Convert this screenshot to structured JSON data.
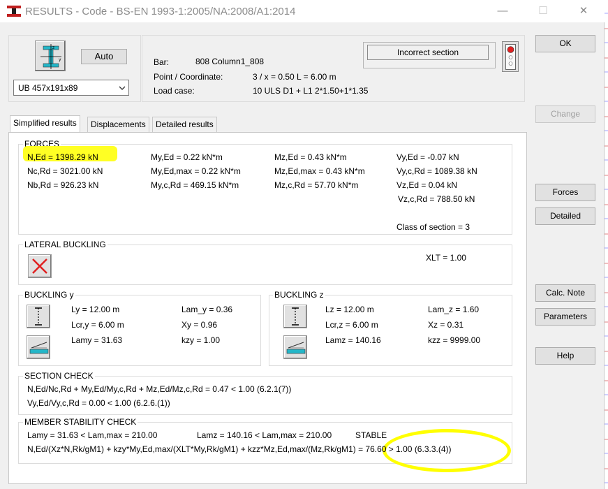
{
  "window": {
    "title": "RESULTS - Code - BS-EN 1993-1:2005/NA:2008/A1:2014",
    "minimize": "—",
    "maximize": "☐",
    "close": "✕"
  },
  "top_left": {
    "auto_label": "Auto",
    "section_value": "UB 457x191x89"
  },
  "info": {
    "bar_label": "Bar:",
    "bar_value": "808  Column1_808",
    "point_label": "Point / Coordinate:",
    "point_value": "3 / x = 0.50 L = 6.00 m",
    "load_label": "Load case:",
    "load_value": "10 ULS D1 + L1  2*1.50+1*1.35"
  },
  "status": {
    "message": "Incorrect section",
    "light_color": "#e02020"
  },
  "tabs": [
    "Simplified results",
    "Displacements",
    "Detailed results"
  ],
  "right_buttons": {
    "ok": "OK",
    "change": "Change",
    "forces": "Forces",
    "detailed": "Detailed",
    "calc_note": "Calc. Note",
    "parameters": "Parameters",
    "help": "Help"
  },
  "forces": {
    "title": "FORCES",
    "col1": [
      "N,Ed = 1398.29 kN",
      "Nc,Rd = 3021.00 kN",
      "Nb,Rd = 926.23 kN"
    ],
    "col2": [
      "My,Ed = 0.22 kN*m",
      "My,Ed,max = 0.22 kN*m",
      "My,c,Rd = 469.15 kN*m"
    ],
    "col3": [
      "Mz,Ed = 0.43 kN*m",
      "Mz,Ed,max = 0.43 kN*m",
      "Mz,c,Rd = 57.70 kN*m"
    ],
    "col4": [
      "Vy,Ed = -0.07 kN",
      "Vy,c,Rd = 1089.38 kN",
      "Vz,Ed = 0.04 kN",
      "Vz,c,Rd = 788.50 kN"
    ],
    "class_text": "Class of section = 3"
  },
  "lateral": {
    "title": "LATERAL BUCKLING",
    "xlt": "XLT = 1.00"
  },
  "buckling_y": {
    "title": "BUCKLING y",
    "left": [
      "Ly = 12.00 m",
      "Lcr,y = 6.00 m",
      "Lamy = 31.63"
    ],
    "right": [
      "Lam_y = 0.36",
      "Xy = 0.96",
      "kzy = 1.00"
    ]
  },
  "buckling_z": {
    "title": "BUCKLING z",
    "left": [
      "Lz = 12.00 m",
      "Lcr,z = 6.00 m",
      "Lamz = 140.16"
    ],
    "right": [
      "Lam_z = 1.60",
      "Xz = 0.31",
      "kzz = 9999.00"
    ]
  },
  "section_check": {
    "title": "SECTION CHECK",
    "line1": "N,Ed/Nc,Rd + My,Ed/My,c,Rd + Mz,Ed/Mz,c,Rd = 0.47 < 1.00   (6.2.1(7))",
    "line2": "Vy,Ed/Vy,c,Rd = 0.00 < 1.00   (6.2.6.(1))"
  },
  "member_check": {
    "title": "MEMBER STABILITY CHECK",
    "lamy": "Lamy = 31.63 < Lam,max = 210.00",
    "lamz": "Lamz = 140.16 < Lam,max = 210.00",
    "stable": "STABLE",
    "line2": "N,Ed/(Xz*N,Rk/gM1) + kzy*My,Ed,max/(XLT*My,Rk/gM1) + kzz*Mz,Ed,max/(Mz,Rk/gM1) = 76.60 > 1.00   (6.3.3.(4))"
  },
  "colors": {
    "highlight": "#ffff00",
    "icon_teal": "#23b6c8",
    "cross_red": "#e02020"
  }
}
